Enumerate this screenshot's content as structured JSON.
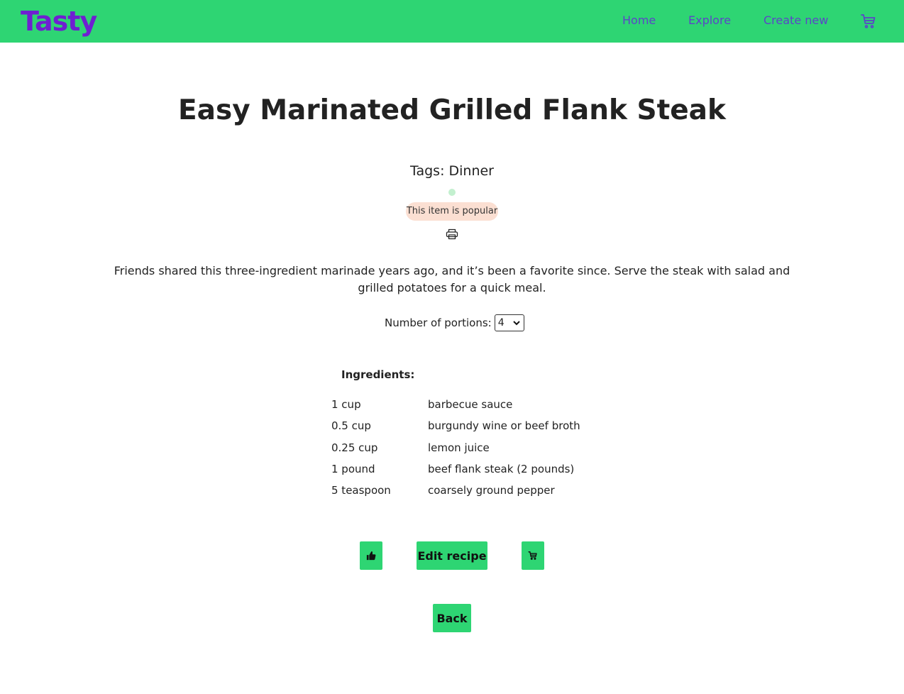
{
  "navbar": {
    "brand": "Tasty",
    "links": [
      "Home",
      "Explore",
      "Create new"
    ],
    "cart_icon": "cart-icon"
  },
  "recipe": {
    "title": "Easy Marinated Grilled Flank Steak",
    "tags_text": "Tags: Dinner",
    "popular_badge": "This item is popular",
    "print_icon": "printer-icon",
    "description": "Friends shared this three-ingredient marinade years ago, and it’s been a favorite since. Serve the steak with salad and grilled potatoes for a quick meal.",
    "portions_label": "Number of portions:",
    "portions_value": "4",
    "ingredients_heading": "Ingredients:",
    "ingredients": [
      {
        "qty": "1 cup",
        "name": "barbecue sauce"
      },
      {
        "qty": "0.5 cup",
        "name": "burgundy wine or beef broth"
      },
      {
        "qty": "0.25 cup",
        "name": "lemon juice"
      },
      {
        "qty": "1 pound",
        "name": "beef flank steak (2 pounds)"
      },
      {
        "qty": "5 teaspoon",
        "name": "coarsely ground pepper"
      }
    ]
  },
  "actions": {
    "like_icon": "thumbs-up-icon",
    "edit_label": "Edit recipe",
    "cart_icon": "cart-icon",
    "back_label": "Back"
  },
  "colors": {
    "accent": "#2ed573",
    "brand": "#6f1fd1",
    "nav_link": "#5b45c9",
    "popular_bg": "#fbdfd2"
  }
}
